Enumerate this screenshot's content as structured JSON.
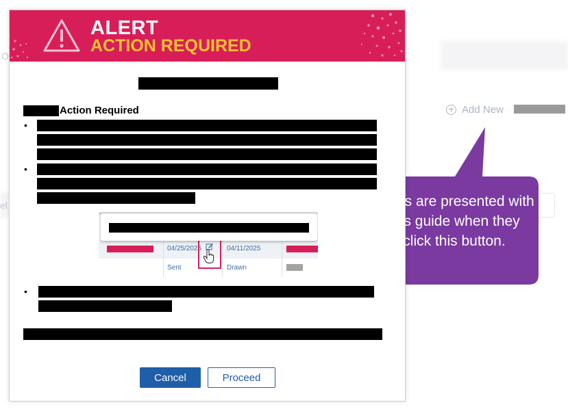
{
  "alert": {
    "title": "ALERT",
    "subtitle": "ACTION REQUIRED",
    "banner_color": "#d81e58",
    "subtitle_color": "#f7c330",
    "icon": "warning-triangle-icon"
  },
  "content": {
    "section_label": "Action Required"
  },
  "embedded": {
    "sent_date": "04/25/2025",
    "drawn_date": "04/11/2025",
    "sent_label": "Sent",
    "drawn_label": "Drawn",
    "edit_icon": "edit-icon",
    "cursor_icon": "hand-pointer-icon"
  },
  "buttons": {
    "cancel": "Cancel",
    "proceed": "Proceed",
    "primary_color": "#1f5ea8"
  },
  "background": {
    "add_new_label": "Add New",
    "add_icon": "plus-circle-icon",
    "left_cut_top": "O",
    "left_cut_mid": "el"
  },
  "callout": {
    "text": "Users are presented with this guide when they click this button.",
    "color": "#7a3aa0"
  }
}
